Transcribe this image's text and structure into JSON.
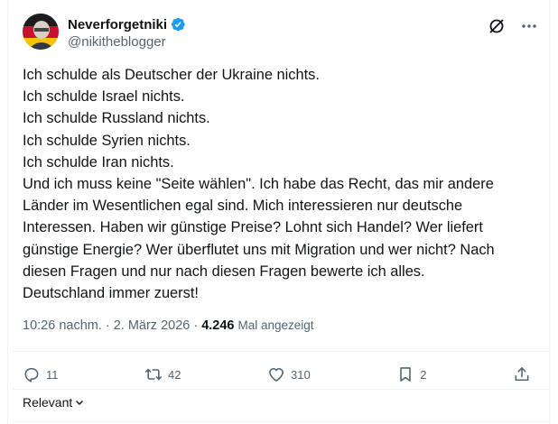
{
  "tweet": {
    "author_name": "Neverforgetniki",
    "handle": "@nikitheblogger",
    "lines": [
      "Ich schulde als Deutscher der Ukraine nichts.",
      "Ich schulde Israel nichts.",
      "Ich schulde Russland nichts.",
      "Ich schulde Syrien nichts.",
      "Ich schulde Iran nichts.",
      "Und ich muss keine \"Seite wählen\". Ich habe das Recht, das mir andere",
      "Länder im Wesentlichen egal sind. Mich interessieren nur deutsche",
      "Interessen. Haben wir günstige Preise? Lohnt sich Handel? Wer liefert",
      "günstige Energie? Wer überflutet uns mit Migration und wer nicht? Nach",
      "diesen Fragen und nur nach diesen Fragen bewerte ich alles.",
      "Deutschland immer zuerst!"
    ],
    "time": "10:26 nachm.",
    "separator": "·",
    "date": "2. März 2026",
    "views": "4.246",
    "views_label": "Mal angezeigt"
  },
  "actions": {
    "replies": "11",
    "reposts": "42",
    "likes": "310",
    "bookmarks": "2"
  },
  "sort_label": "Relevant",
  "icons": [
    "verified-badge-icon",
    "grok-icon",
    "more-icon",
    "reply-icon",
    "repost-icon",
    "like-icon",
    "bookmark-icon",
    "share-icon",
    "chevron-down-icon"
  ],
  "colors": {
    "verified": "#1d9bf0",
    "text": "#0f1419",
    "muted": "#536471"
  }
}
